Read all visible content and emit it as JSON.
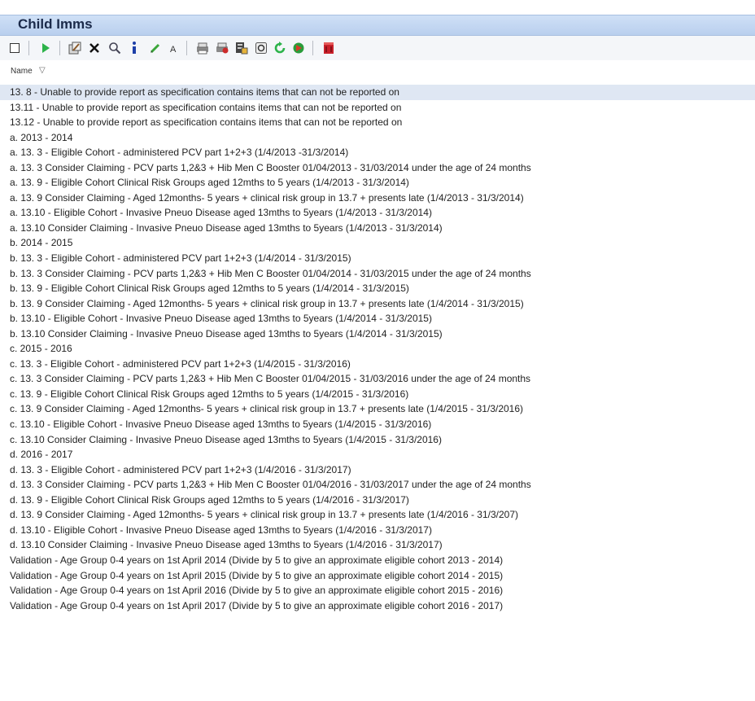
{
  "window": {
    "title": "Child Imms"
  },
  "toolbar": {
    "buttons": [
      {
        "name": "select-all-icon"
      },
      {
        "name": "run-icon"
      },
      {
        "name": "edit-icon"
      },
      {
        "name": "delete-icon"
      },
      {
        "name": "search-icon"
      },
      {
        "name": "info-icon"
      },
      {
        "name": "pencil-icon"
      },
      {
        "name": "font-icon"
      },
      {
        "name": "print-icon"
      },
      {
        "name": "export-icon"
      },
      {
        "name": "report-icon"
      },
      {
        "name": "view-icon"
      },
      {
        "name": "refresh-icon"
      },
      {
        "name": "navigate-icon"
      },
      {
        "name": "close-icon"
      }
    ]
  },
  "list": {
    "column_header": "Name",
    "sort_indicator": "▽",
    "items": [
      "13. 8  - Unable to provide report as specification contains items that can not be reported on",
      "13.11  - Unable to provide report as specification contains items that can not be reported on",
      "13.12  - Unable to provide report as specification contains items that can not be reported on",
      "a.  2013 - 2014",
      "a. 13. 3 - Eligible Cohort - administered PCV part 1+2+3 (1/4/2013 -31/3/2014)",
      "a. 13. 3 Consider Claiming - PCV parts 1,2&3 + Hib Men C Booster 01/04/2013 - 31/03/2014 under the age of 24 months",
      "a. 13. 9 - Eligible Cohort Clinical Risk Groups aged 12mths to 5 years (1/4/2013 - 31/3/2014)",
      "a. 13. 9 Consider Claiming - Aged 12months- 5 years + clinical risk group in 13.7 + presents late (1/4/2013 - 31/3/2014)",
      "a. 13.10 - Eligible Cohort - Invasive Pneuo Disease aged 13mths to 5years (1/4/2013 - 31/3/2014)",
      "a. 13.10 Consider Claiming - Invasive Pneuo Disease aged 13mths to 5years (1/4/2013 - 31/3/2014)",
      "b.  2014 - 2015",
      "b. 13. 3 - Eligible Cohort - administered PCV part 1+2+3 (1/4/2014 - 31/3/2015)",
      "b. 13. 3 Consider Claiming - PCV parts 1,2&3 + Hib Men C Booster 01/04/2014 - 31/03/2015 under the age of 24 months",
      "b. 13. 9 - Eligible Cohort Clinical Risk Groups aged 12mths to 5 years (1/4/2014 - 31/3/2015)",
      "b. 13. 9 Consider Claiming - Aged 12months- 5 years + clinical risk group in 13.7 + presents late (1/4/2014 - 31/3/2015)",
      "b. 13.10 - Eligible Cohort - Invasive Pneuo Disease aged 13mths to 5years (1/4/2014 - 31/3/2015)",
      "b. 13.10 Consider Claiming - Invasive Pneuo Disease aged 13mths to 5years (1/4/2014 - 31/3/2015)",
      "c.  2015 - 2016",
      "c. 13. 3 - Eligible Cohort - administered PCV part 1+2+3 (1/4/2015 - 31/3/2016)",
      "c. 13. 3 Consider Claiming - PCV parts 1,2&3 + Hib Men C Booster 01/04/2015 - 31/03/2016 under the age of 24 months",
      "c. 13. 9 - Eligible Cohort Clinical Risk Groups aged 12mths to 5 years (1/4/2015 - 31/3/2016)",
      "c. 13. 9 Consider Claiming - Aged 12months- 5 years + clinical risk group in 13.7 + presents late (1/4/2015 - 31/3/2016)",
      "c. 13.10 - Eligible Cohort - Invasive Pneuo Disease aged 13mths to 5years (1/4/2015 - 31/3/2016)",
      "c. 13.10 Consider Claiming - Invasive Pneuo Disease aged 13mths to 5years (1/4/2015 - 31/3/2016)",
      "d.  2016 - 2017",
      "d. 13. 3 - Eligible Cohort - administered PCV part 1+2+3 (1/4/2016 - 31/3/2017)",
      "d. 13. 3 Consider Claiming - PCV parts 1,2&3 + Hib Men C Booster 01/04/2016 - 31/03/2017 under the age of 24 months",
      "d. 13. 9 - Eligible Cohort Clinical Risk Groups aged 12mths to 5 years (1/4/2016 - 31/3/2017)",
      "d. 13. 9 Consider Claiming - Aged 12months- 5 years + clinical risk group in 13.7 + presents late (1/4/2016 - 31/3/207)",
      "d. 13.10 - Eligible Cohort - Invasive Pneuo Disease aged 13mths to 5years (1/4/2016 - 31/3/2017)",
      "d. 13.10 Consider Claiming - Invasive Pneuo Disease aged 13mths to 5years (1/4/2016 - 31/3/2017)",
      "Validation  - Age Group 0-4 years on 1st April 2014 (Divide by 5 to give an approximate eligible cohort 2013 - 2014)",
      "Validation  - Age Group 0-4 years on 1st April 2015 (Divide by 5 to give an approximate eligible cohort 2014 - 2015)",
      "Validation  - Age Group 0-4 years on 1st April 2016 (Divide by 5 to give an approximate eligible cohort 2015 - 2016)",
      "Validation  - Age Group 0-4 years on 1st April 2017 (Divide by 5 to give an approximate eligible cohort 2016 - 2017)"
    ]
  },
  "colors": {
    "title_bar": "#c4d7f2",
    "selection": "#dfe7f3"
  }
}
